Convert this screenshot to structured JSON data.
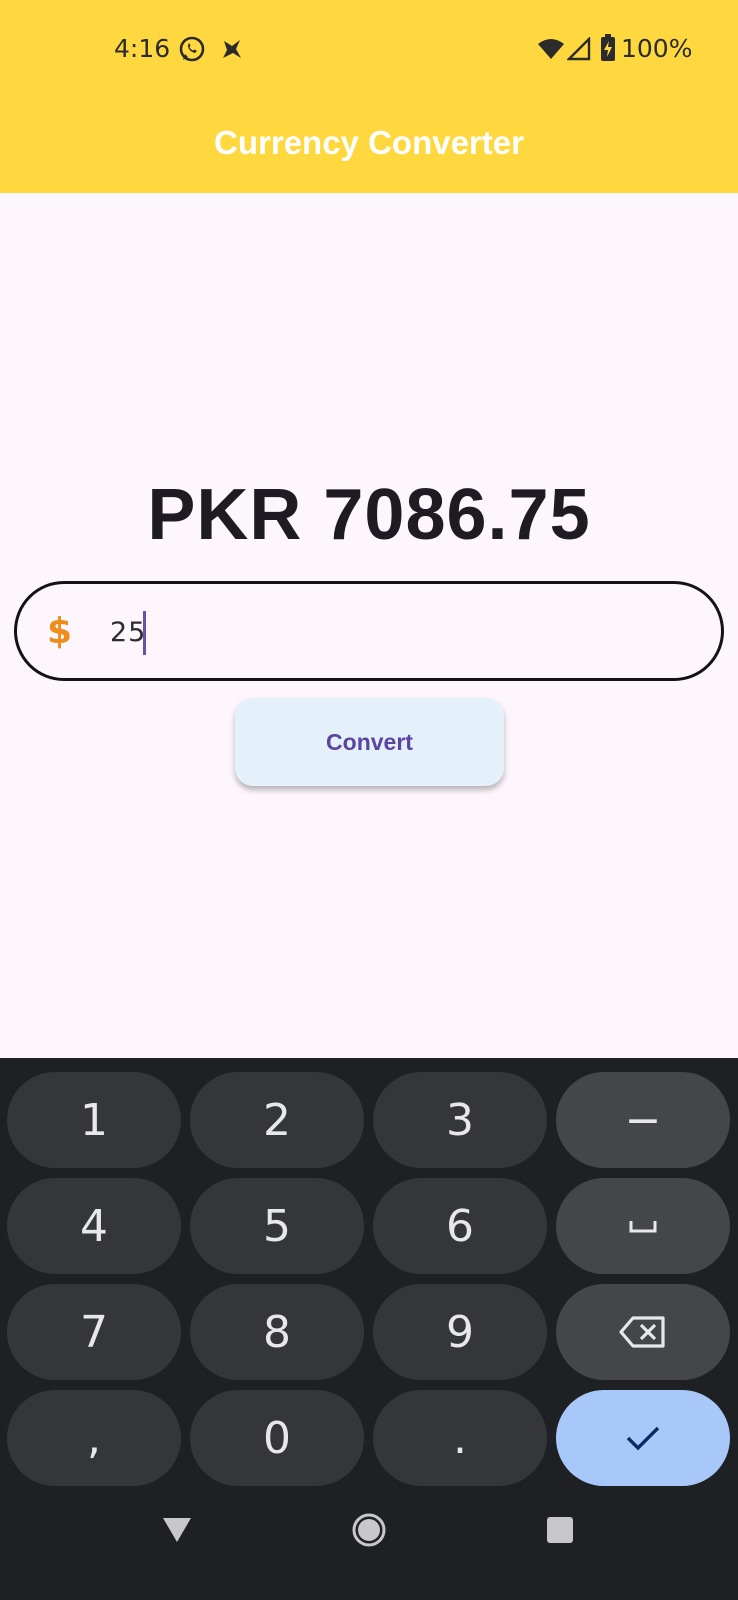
{
  "status_bar": {
    "time": "4:16",
    "battery": "100%",
    "icons": [
      "whatsapp-icon",
      "notification-icon",
      "wifi-icon",
      "signal-icon",
      "battery-charging-icon"
    ]
  },
  "app_bar": {
    "title": "Currency Converter",
    "background": "#ffd83f"
  },
  "main": {
    "result": "PKR 7086.75",
    "amount_field": {
      "prefix_icon": "$",
      "value": "25"
    },
    "convert_label": "Convert"
  },
  "keyboard": {
    "keys": [
      "1",
      "2",
      "3",
      "−",
      "4",
      "5",
      "6",
      "␣",
      "7",
      "8",
      "9",
      "⌫",
      ",",
      "0",
      ".",
      "✓"
    ],
    "colors": {
      "key": "#35363a",
      "function_key": "#44464a",
      "enter_key": "#a8c8fa"
    }
  },
  "nav_bar": {
    "buttons": [
      "back-icon",
      "home-icon",
      "recents-icon"
    ]
  }
}
